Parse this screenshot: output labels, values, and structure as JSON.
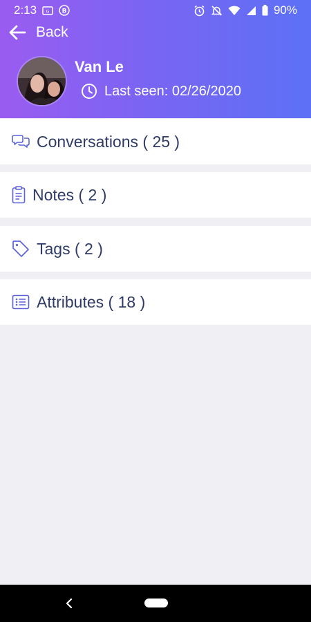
{
  "status_bar": {
    "time": "2:13",
    "battery": "90%",
    "icons": [
      "photo-icon",
      "b-badge-icon",
      "alarm-icon",
      "mute-icon",
      "wifi-icon",
      "signal-icon",
      "battery-icon"
    ]
  },
  "header": {
    "back_label": "Back",
    "contact_name": "Van Le",
    "last_seen": "Last seen: 02/26/2020",
    "gradient": [
      "#9a5cf0",
      "#5c71f6"
    ]
  },
  "menu": {
    "items": [
      {
        "label": "Conversations ( 25 )",
        "icon": "chat-bubbles-icon"
      },
      {
        "label": "Notes ( 2 )",
        "icon": "clipboard-icon"
      },
      {
        "label": "Tags ( 2 )",
        "icon": "tag-icon"
      },
      {
        "label": "Attributes ( 18 )",
        "icon": "list-icon"
      }
    ]
  },
  "colors": {
    "accent": "#5a62d8",
    "label_text": "#2f3a66",
    "background": "#efeff4"
  }
}
